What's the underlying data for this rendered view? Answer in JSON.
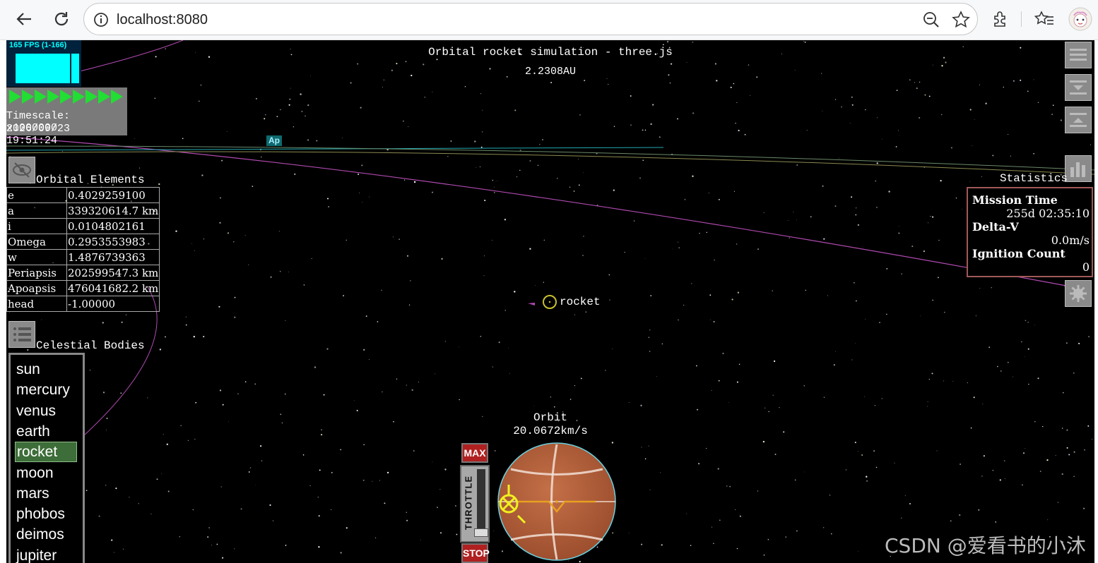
{
  "browser": {
    "url": "localhost:8080",
    "icons": [
      "back-icon",
      "reload-icon",
      "site-info-icon",
      "zoom-out-icon",
      "bookmark-star-icon",
      "extensions-icon",
      "favorites-icon",
      "profile-avatar-icon"
    ]
  },
  "sim": {
    "fps_label": "165 FPS (1-166)",
    "timescale": "Timescale: x1000000",
    "date": "2026/09/23 19:51:24",
    "title": "Orbital rocket simulation - three.js",
    "distance": "2.2308AU",
    "ap_marker": "Ap",
    "rocket_label": "rocket"
  },
  "orbital_elements": {
    "heading": "Orbital  Elements",
    "rows": [
      {
        "key": "e",
        "value": "0.4029259100"
      },
      {
        "key": "a",
        "value": "339320614.7 km"
      },
      {
        "key": "i",
        "value": "0.0104802161"
      },
      {
        "key": "Omega",
        "value": "0.2953553983"
      },
      {
        "key": "w",
        "value": "1.4876739363"
      },
      {
        "key": "Periapsis",
        "value": "202599547.3 km"
      },
      {
        "key": "Apoapsis",
        "value": "476041682.2 km"
      },
      {
        "key": "head",
        "value": "-1.00000"
      }
    ]
  },
  "celestial_bodies": {
    "heading": "Celestial  Bodies",
    "items": [
      "sun",
      "mercury",
      "venus",
      "earth",
      "rocket",
      "moon",
      "mars",
      "phobos",
      "deimos",
      "jupiter"
    ],
    "selected": "rocket"
  },
  "statistics": {
    "heading": "Statistics",
    "mission_time_label": "Mission Time",
    "mission_time": "255d 02:35:10",
    "delta_v_label": "Delta-V",
    "delta_v": "0.0m/s",
    "ignition_label": "Ignition  Count",
    "ignition_count": "0"
  },
  "navball": {
    "mode": "Orbit",
    "speed": "20.0672km/s",
    "max_label": "MAX",
    "stop_label": "STOP",
    "throttle_label": "THROTTLE",
    "throttle_level": 0.0
  },
  "watermark": "CSDN @爱看书的小沐",
  "colors": {
    "fps_cyan": "#00ffff",
    "timescale_green": "#22dd33",
    "selected_item": "#3d6d38",
    "navball_brown": "#b4603c",
    "stats_border": "#a05858",
    "orbit_magenta": "#b04ab0"
  }
}
